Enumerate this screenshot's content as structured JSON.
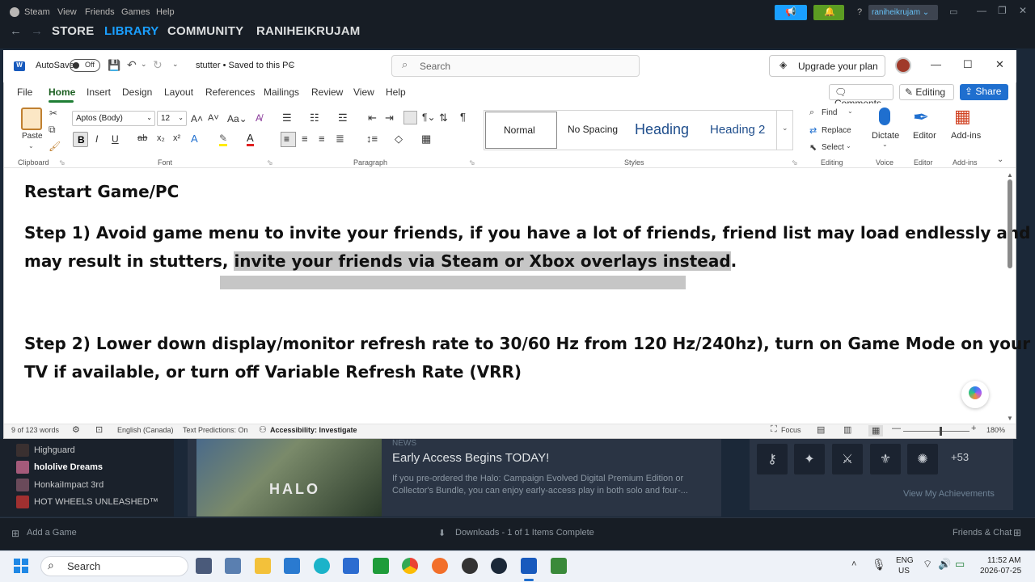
{
  "steam": {
    "menu": [
      "Steam",
      "View",
      "Friends",
      "Games",
      "Help"
    ],
    "nav": [
      "STORE",
      "LIBRARY",
      "COMMUNITY",
      "RANIHEIKRUJAM"
    ],
    "username": "raniheikrujam",
    "help_symbol": "?",
    "games": [
      "Highguard",
      "hololive Dreams",
      "HonkaiImpact 3rd",
      "HOT WHEELS UNLEASHED™"
    ],
    "news": {
      "tag": "NEWS",
      "title": "Early Access Begins TODAY!",
      "body": "If you pre-ordered the Halo: Campaign Evolved Digital Premium Edition or Collector's Bundle, you can enjoy early-access play in both solo and four-...",
      "image_text": "HALO"
    },
    "achievements": {
      "more": "+53",
      "view_all": "View My Achievements"
    },
    "bottom": {
      "add_game": "Add a Game",
      "downloads": "Downloads - 1 of 1 Items Complete",
      "friends_chat": "Friends & Chat"
    }
  },
  "word": {
    "titlebar": {
      "autosave": "AutoSave",
      "autosave_state": "Off",
      "doc_title": "stutter • Saved to this PC",
      "search_placeholder": "Search",
      "upgrade": "Upgrade your plan"
    },
    "tabs": [
      "File",
      "Home",
      "Insert",
      "Design",
      "Layout",
      "References",
      "Mailings",
      "Review",
      "View",
      "Help"
    ],
    "actions": {
      "comments": "Comments",
      "editing": "Editing",
      "share": "Share"
    },
    "ribbon": {
      "clipboard": {
        "paste": "Paste",
        "label": "Clipboard"
      },
      "font": {
        "family": "Aptos (Body)",
        "size": "12",
        "label": "Font"
      },
      "paragraph": {
        "label": "Paragraph"
      },
      "styles": {
        "items": [
          "Normal",
          "No Spacing",
          "Heading",
          "Heading 2"
        ],
        "label": "Styles"
      },
      "editing": {
        "find": "Find",
        "replace": "Replace",
        "select": "Select",
        "label": "Editing"
      },
      "voice": {
        "dictate": "Dictate",
        "label": "Voice"
      },
      "editor": {
        "name": "Editor",
        "label": "Editor"
      },
      "addins": {
        "name": "Add-ins",
        "label": "Add-ins"
      }
    },
    "document": {
      "heading": "Restart Game/PC",
      "step1_a": "Step 1) Avoid game menu to invite your friends, if you have a lot of friends, friend list may load endlessly and",
      "step1_b": "may result in stutters, ",
      "step1_sel": "invite your friends via Steam or Xbox overlays instead",
      "step1_end": ".",
      "step2_a": "Step 2) Lower down display/monitor refresh rate to 30/60 Hz from 120 Hz/240hz), turn on Game Mode on your",
      "step2_b": "TV if available, or turn off Variable Refresh Rate (VRR)"
    },
    "status": {
      "words": "9 of 123 words",
      "language": "English (Canada)",
      "predictions": "Text Predictions: On",
      "accessibility": "Accessibility: Investigate",
      "focus": "Focus",
      "zoom": "180%"
    }
  },
  "taskbar": {
    "search": "Search",
    "lang": "ENG",
    "region": "US",
    "time": "11:52 AM",
    "date": "2026-07-25"
  }
}
